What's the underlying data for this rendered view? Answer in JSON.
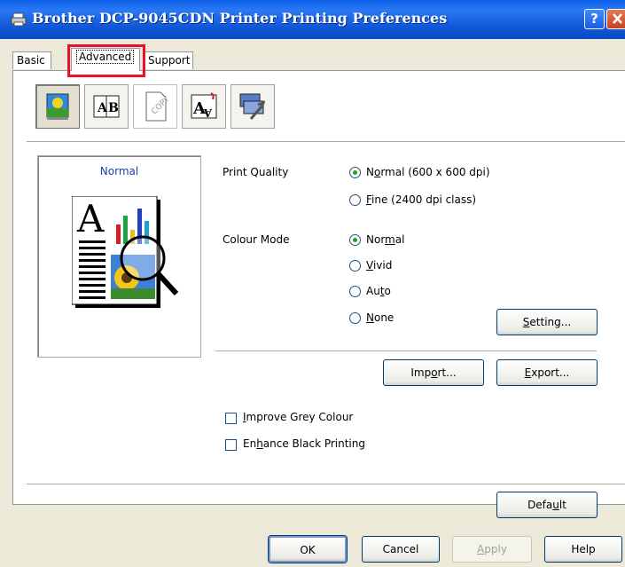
{
  "window": {
    "title": "Brother DCP-9045CDN Printer Printing Preferences",
    "help_glyph": "?"
  },
  "tabs": [
    {
      "label": "Basic"
    },
    {
      "label": "Advanced"
    },
    {
      "label": "Support"
    }
  ],
  "toolbar_icons": [
    "colour-icon",
    "layout-icon",
    "watermark-icon",
    "page-setting-icon",
    "device-options-icon"
  ],
  "preview": {
    "label": "Normal"
  },
  "print_quality": {
    "label": "Print Quality",
    "options": [
      {
        "pre": "N",
        "u": "o",
        "post": "rmal (600 x 600 dpi)",
        "selected": true
      },
      {
        "pre": "",
        "u": "F",
        "post": "ine (2400 dpi class)",
        "selected": false
      }
    ]
  },
  "colour_mode": {
    "label": "Colour Mode",
    "options": [
      {
        "pre": "Nor",
        "u": "m",
        "post": "al",
        "selected": true
      },
      {
        "pre": "",
        "u": "V",
        "post": "ivid",
        "selected": false
      },
      {
        "pre": "Au",
        "u": "t",
        "post": "o",
        "selected": false
      },
      {
        "pre": "",
        "u": "N",
        "post": "one",
        "selected": false
      }
    ]
  },
  "buttons": {
    "setting": {
      "pre": "",
      "u": "S",
      "post": "etting..."
    },
    "import": {
      "pre": "Imp",
      "u": "o",
      "post": "rt..."
    },
    "export": {
      "pre": "",
      "u": "E",
      "post": "xport..."
    },
    "default": {
      "pre": "Defa",
      "u": "u",
      "post": "lt"
    },
    "ok": "OK",
    "cancel": "Cancel",
    "apply": {
      "pre": "",
      "u": "A",
      "post": "pply"
    },
    "help": "Help"
  },
  "checkboxes": [
    {
      "pre": "",
      "u": "I",
      "post": "mprove Grey Colour",
      "checked": false
    },
    {
      "pre": "En",
      "u": "h",
      "post": "ance Black Printing",
      "checked": false
    }
  ]
}
